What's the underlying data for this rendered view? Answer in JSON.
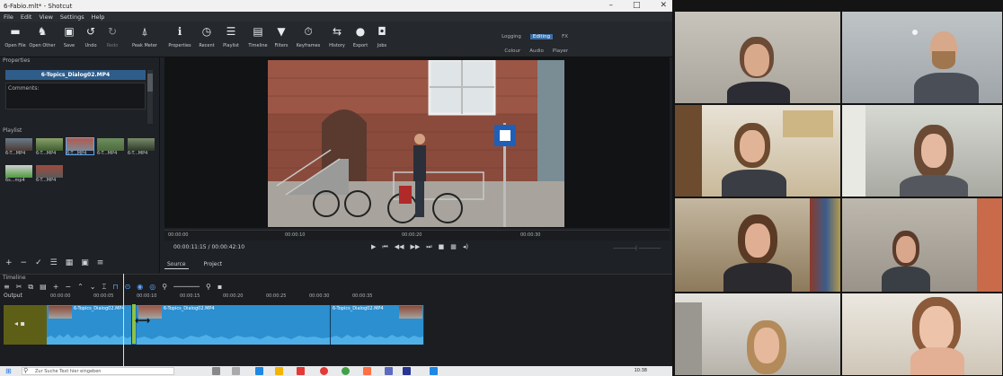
{
  "window": {
    "title": "6-Fabio.mlt* - Shotcut",
    "controls": [
      "–",
      "□",
      "✕"
    ]
  },
  "menu": [
    "File",
    "Edit",
    "View",
    "Settings",
    "Help"
  ],
  "toolbar": [
    {
      "label": "Open File",
      "icon": "folder-icon"
    },
    {
      "label": "Open Other",
      "icon": "open-other-icon"
    },
    {
      "label": "Save",
      "icon": "save-icon"
    },
    {
      "label": "Undo",
      "icon": "undo-icon"
    },
    {
      "label": "Redo",
      "icon": "redo-icon"
    },
    {
      "label": "Peak Meter",
      "icon": "peak-meter-icon"
    },
    {
      "label": "Properties",
      "icon": "info-icon"
    },
    {
      "label": "Recent",
      "icon": "clock-icon"
    },
    {
      "label": "Playlist",
      "icon": "list-icon"
    },
    {
      "label": "Timeline",
      "icon": "timeline-icon"
    },
    {
      "label": "Filters",
      "icon": "filter-icon"
    },
    {
      "label": "Keyframes",
      "icon": "stopwatch-icon"
    },
    {
      "label": "History",
      "icon": "history-icon"
    },
    {
      "label": "Export",
      "icon": "export-icon"
    },
    {
      "label": "Jobs",
      "icon": "jobs-icon"
    }
  ],
  "layouts_top": [
    "Logging",
    "Editing",
    "FX"
  ],
  "layouts_active": "Editing",
  "layouts_bottom": [
    "Colour",
    "Audio",
    "Player"
  ],
  "properties": {
    "header": "Properties",
    "clip_name": "6-Topics_Dialog02.MP4",
    "comments_label": "Comments:"
  },
  "playlist": {
    "header": "Playlist",
    "items": [
      "6-T...MP4",
      "6-T...MP4",
      "6-T...MP4",
      "6-T...MP4",
      "6-T...MP4",
      "6s...mp4",
      "6-T...MP4"
    ]
  },
  "viewer": {
    "ruler": [
      "00:00:00",
      "00:00:10",
      "00:00:20",
      "00:00:30"
    ],
    "timecode": "00:00:11:15",
    "duration": "/ 00:00:42:10",
    "source_tab": "Source",
    "project_tab": "Project"
  },
  "timeline": {
    "header": "Timeline",
    "track_label": "Output",
    "ruler": [
      "00:00:00",
      "00:00:05",
      "00:00:10",
      "00:00:15",
      "00:00:20",
      "00:00:25",
      "00:00:30",
      "00:00:35"
    ],
    "clips": [
      "6-Topics_Dialog02.MP4",
      "6-Topics_Dialog02.MP4",
      "6-Topics_Dialog02.MP4"
    ]
  },
  "taskbar": {
    "search_placeholder": "Zur Suche Text hier eingeben",
    "time": "10:38"
  }
}
